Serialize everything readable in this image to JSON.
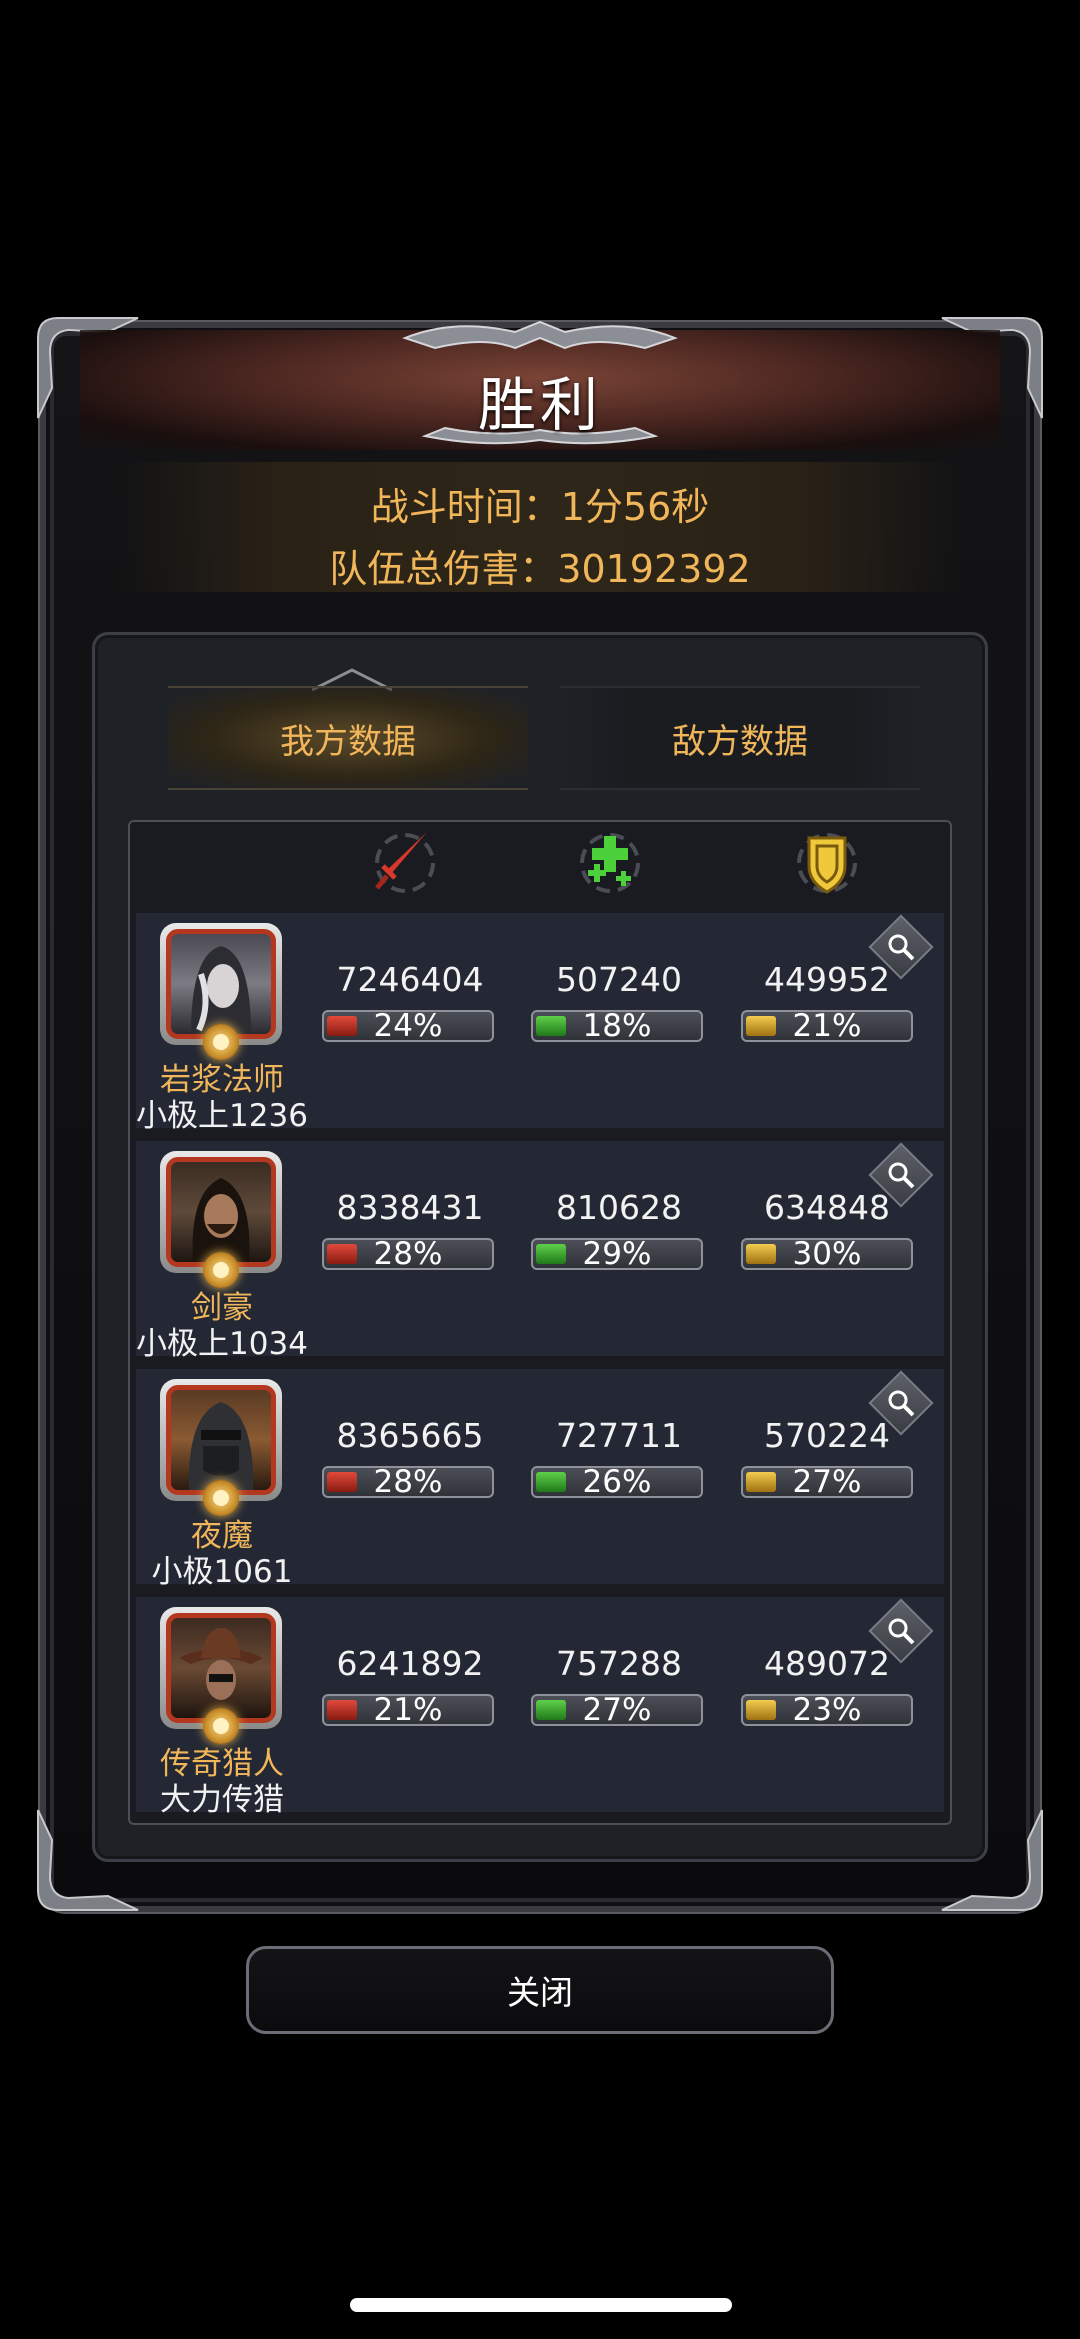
{
  "title": "胜利",
  "info": {
    "battle_time": "战斗时间：1分56秒",
    "team_damage": "队伍总伤害：30192392"
  },
  "tabs": [
    {
      "label": "我方数据",
      "active": true
    },
    {
      "label": "敌方数据",
      "active": false
    }
  ],
  "columns": [
    {
      "icon": "sword-icon",
      "color": "#d8382a"
    },
    {
      "icon": "heal-cross-icon",
      "color": "#4cd13a"
    },
    {
      "icon": "shield-icon",
      "color": "#f0c93a"
    }
  ],
  "rows": [
    {
      "hero": "岩浆法师",
      "player": "小极上1236",
      "damage": "7246404",
      "damage_pct": "24%",
      "heal": "507240",
      "heal_pct": "18%",
      "tank": "449952",
      "tank_pct": "21%"
    },
    {
      "hero": "剑豪",
      "player": "小极上1034",
      "damage": "8338431",
      "damage_pct": "28%",
      "heal": "810628",
      "heal_pct": "29%",
      "tank": "634848",
      "tank_pct": "30%"
    },
    {
      "hero": "夜魔",
      "player": "小极1061",
      "damage": "8365665",
      "damage_pct": "28%",
      "heal": "727711",
      "heal_pct": "26%",
      "tank": "570224",
      "tank_pct": "27%"
    },
    {
      "hero": "传奇猎人",
      "player": "大力传猎",
      "damage": "6241892",
      "damage_pct": "21%",
      "heal": "757288",
      "heal_pct": "27%",
      "tank": "489072",
      "tank_pct": "23%"
    }
  ],
  "close_label": "关闭"
}
